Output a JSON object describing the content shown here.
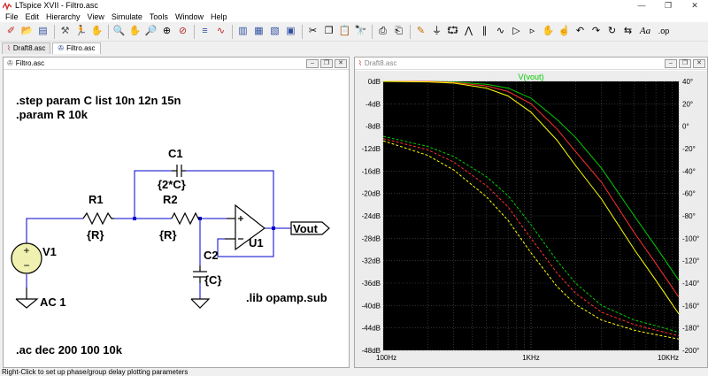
{
  "app": {
    "title": "LTspice XVII - Filtro.asc",
    "window_controls": [
      "—",
      "❐",
      "✕"
    ]
  },
  "menu": [
    {
      "label": "File"
    },
    {
      "label": "Edit"
    },
    {
      "label": "Hierarchy"
    },
    {
      "label": "View"
    },
    {
      "label": "Simulate"
    },
    {
      "label": "Tools"
    },
    {
      "label": "Window"
    },
    {
      "label": "Help"
    }
  ],
  "toolbar_text": {
    "font_button": "Aa",
    "spice_directive": ".op"
  },
  "tabs": [
    {
      "label": "Draft8.asc"
    },
    {
      "label": "Filtro.asc"
    }
  ],
  "schematic": {
    "window_title": "Filtro.asc",
    "directives": {
      "step": ".step param C list 10n 12n 15n",
      "param": ".param R 10k",
      "lib": ".lib opamp.sub",
      "ac": ".ac dec 200 100 10k"
    },
    "components": {
      "v1": {
        "name": "V1",
        "value": "AC 1"
      },
      "r1": {
        "name": "R1",
        "value": "{R}"
      },
      "r2": {
        "name": "R2",
        "value": "{R}"
      },
      "c1": {
        "name": "C1",
        "value": "{2*C}"
      },
      "c2": {
        "name": "C2",
        "value": "{C}"
      },
      "u1": {
        "name": "U1"
      },
      "vout": {
        "label": "Vout"
      }
    }
  },
  "plot": {
    "window_title": "Draft8.asc",
    "trace_label": "V(vout)",
    "trace_label_color": "#00cc00",
    "background": "#000000",
    "grid_color": "#555555"
  },
  "chart_data": {
    "type": "line",
    "title": "V(vout)",
    "x_scale": "log",
    "xlim": [
      100,
      10000
    ],
    "x_ticks": [
      "100Hz",
      "1KHz",
      "10KHz"
    ],
    "ylim": [
      -48,
      0
    ],
    "y_ticks": [
      "0dB",
      "-4dB",
      "-8dB",
      "-12dB",
      "-16dB",
      "-20dB",
      "-24dB",
      "-28dB",
      "-32dB",
      "-36dB",
      "-40dB",
      "-44dB",
      "-48dB"
    ],
    "y2lim": [
      -200,
      40
    ],
    "y2_ticks": [
      "40°",
      "20°",
      "0°",
      "-20°",
      "-40°",
      "-60°",
      "-80°",
      "-100°",
      "-120°",
      "-140°",
      "-160°",
      "-180°",
      "-200°"
    ],
    "grid": true,
    "series": [
      {
        "color": "#00cc00",
        "kind": "magnitude",
        "dashed": false,
        "x": [
          100,
          200,
          300,
          500,
          700,
          1000,
          1500,
          2000,
          3000,
          5000,
          7000,
          10000
        ],
        "y": [
          0,
          0,
          -0.1,
          -0.5,
          -1.2,
          -3,
          -6.8,
          -10,
          -15.5,
          -24,
          -29.5,
          -35.5
        ]
      },
      {
        "color": "#ff3030",
        "kind": "magnitude",
        "dashed": false,
        "x": [
          100,
          200,
          300,
          500,
          700,
          1000,
          1500,
          2000,
          3000,
          5000,
          7000,
          10000
        ],
        "y": [
          0,
          0,
          -0.2,
          -0.8,
          -1.8,
          -4,
          -8.5,
          -12.5,
          -18,
          -27,
          -32.5,
          -38.5
        ]
      },
      {
        "color": "#ffff00",
        "kind": "magnitude",
        "dashed": false,
        "x": [
          100,
          200,
          300,
          500,
          700,
          1000,
          1500,
          2000,
          3000,
          5000,
          7000,
          10000
        ],
        "y": [
          0,
          -0.1,
          -0.3,
          -1.2,
          -2.6,
          -5.5,
          -10.5,
          -15,
          -21,
          -30,
          -35.5,
          -41.5
        ]
      },
      {
        "color": "#00cc00",
        "kind": "phase",
        "dashed": true,
        "x": [
          100,
          200,
          300,
          500,
          700,
          1000,
          1500,
          2000,
          3000,
          5000,
          7000,
          10000
        ],
        "y": [
          -9,
          -18,
          -27,
          -45,
          -62,
          -88,
          -120,
          -140,
          -160,
          -173,
          -178,
          -184
        ]
      },
      {
        "color": "#ff3030",
        "kind": "phase",
        "dashed": true,
        "x": [
          100,
          200,
          300,
          500,
          700,
          1000,
          1500,
          2000,
          3000,
          5000,
          7000,
          10000
        ],
        "y": [
          -11,
          -21,
          -32,
          -53,
          -72,
          -100,
          -131,
          -149,
          -166,
          -177,
          -182,
          -187
        ]
      },
      {
        "color": "#ffff00",
        "kind": "phase",
        "dashed": true,
        "x": [
          100,
          200,
          300,
          500,
          700,
          1000,
          1500,
          2000,
          3000,
          5000,
          7000,
          10000
        ],
        "y": [
          -13,
          -26,
          -39,
          -63,
          -84,
          -113,
          -143,
          -159,
          -173,
          -182,
          -186,
          -190
        ]
      }
    ]
  },
  "status": "Right-Click to set up phase/group delay plotting parameters"
}
